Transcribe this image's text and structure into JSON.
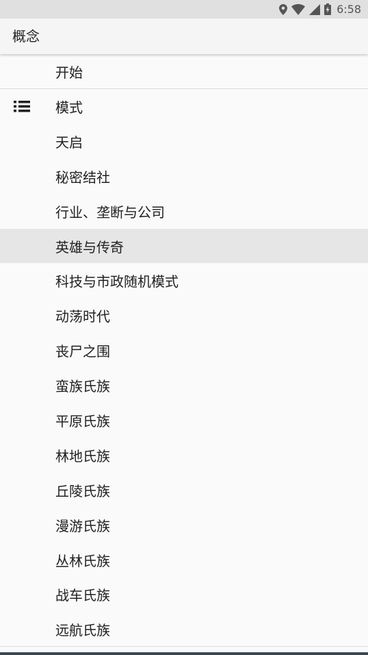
{
  "status_bar": {
    "time": "6:58",
    "icons": [
      "location-icon",
      "wifi-icon",
      "signal-icon",
      "battery-charging-icon"
    ]
  },
  "app_bar": {
    "title": "概念"
  },
  "top_item": {
    "label": "开始"
  },
  "list": {
    "icon": "list-icon",
    "selected_index": 4,
    "items": [
      {
        "label": "模式"
      },
      {
        "label": "天启"
      },
      {
        "label": "秘密结社"
      },
      {
        "label": "行业、垄断与公司"
      },
      {
        "label": "英雄与传奇"
      },
      {
        "label": "科技与市政随机模式"
      },
      {
        "label": "动荡时代"
      },
      {
        "label": "丧尸之围"
      },
      {
        "label": "蛮族氏族"
      },
      {
        "label": "平原氏族"
      },
      {
        "label": "林地氏族"
      },
      {
        "label": "丘陵氏族"
      },
      {
        "label": "漫游氏族"
      },
      {
        "label": "丛林氏族"
      },
      {
        "label": "战车氏族"
      },
      {
        "label": "远航氏族"
      }
    ]
  },
  "colors": {
    "status_bar_bg": "#e0e0e0",
    "app_bar_bg": "#f5f5f5",
    "page_bg": "#fafafa",
    "selected_row_bg": "#e6e6e6",
    "text": "#212121"
  }
}
